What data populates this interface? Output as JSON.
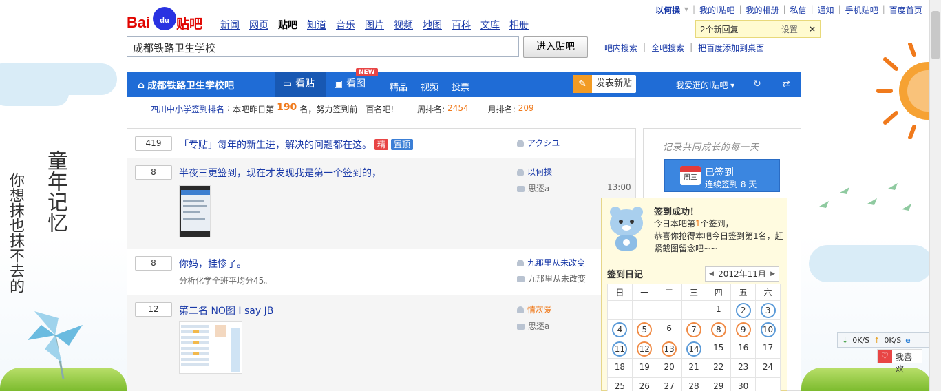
{
  "logo": {
    "bai": "Bai",
    "du": "du",
    "tieba": "贴吧"
  },
  "nav": [
    "新闻",
    "网页",
    "贴吧",
    "知道",
    "音乐",
    "图片",
    "视频",
    "地图",
    "百科",
    "文库",
    "相册"
  ],
  "nav_current": "贴吧",
  "search": {
    "value": "成都铁路卫生学校",
    "button": "进入贴吧"
  },
  "sublinks": [
    "吧内搜索",
    "全吧搜索",
    "把百度添加到桌面"
  ],
  "toplinks": {
    "user": "以何操",
    "items": [
      "我的i贴吧",
      "我的相册",
      "私信",
      "通知",
      "手机贴吧",
      "百度首页"
    ]
  },
  "notify": {
    "text": "2个新回复",
    "setting": "设置",
    "close": "×"
  },
  "bar": {
    "name": "成都铁路卫生学校吧",
    "tabs": [
      "看贴",
      "看图"
    ],
    "new": "NEW",
    "links": [
      "精品",
      "视频",
      "投票"
    ],
    "post": "发表新贴",
    "fav": "我爱逛的i贴吧"
  },
  "rank": {
    "label": "四川中小学签到排名",
    "pre": "本吧昨日第",
    "num": "190",
    "post": "名，努力签到前一百名吧!",
    "week_label": "周排名:",
    "week": "2454",
    "month_label": "月排名:",
    "month": "209"
  },
  "threads": [
    {
      "count": "419",
      "title": "「专贴」每年的新生进，解决的问题都在这。",
      "badges": [
        "精",
        "置顶"
      ],
      "author": "アクシユ"
    },
    {
      "count": "8",
      "title": "半夜三更签到，现在才发现我是第一个签到的，",
      "author": "以何操",
      "replier": "思逐a",
      "time": "13:00"
    },
    {
      "count": "8",
      "title": "你妈，挂惨了。",
      "abstract": "分析化学全班平均分45。",
      "author": "九那里从未改变",
      "replier": "九那里从未改变"
    },
    {
      "count": "12",
      "title": "第二名 NO图 I say JB",
      "author": "情灰爱",
      "replier": "思逐a"
    }
  ],
  "side": {
    "motto": "记录共同成长的每一天",
    "signed": "已签到",
    "days": "连续签到 8 天",
    "weekday": "周三"
  },
  "popup": {
    "title": "签到成功！",
    "line1a": "今日本吧第",
    "line1n": "1",
    "line1b": "个签到，",
    "line2": "恭喜你抢得本吧今日签到第1名，赶紧截图留念吧~~",
    "diary": "签到日记",
    "month": "2012年11月"
  },
  "calendar": {
    "head": [
      "日",
      "一",
      "二",
      "三",
      "四",
      "五",
      "六"
    ],
    "weeks": [
      [
        {
          "d": ""
        },
        {
          "d": ""
        },
        {
          "d": ""
        },
        {
          "d": ""
        },
        {
          "d": "1"
        },
        {
          "d": "2",
          "m": "b"
        },
        {
          "d": "3",
          "m": "b"
        }
      ],
      [
        {
          "d": "4",
          "m": "b"
        },
        {
          "d": "5",
          "m": "o"
        },
        {
          "d": "6"
        },
        {
          "d": "7",
          "m": "o"
        },
        {
          "d": "8",
          "m": "o"
        },
        {
          "d": "9",
          "m": "o"
        },
        {
          "d": "10",
          "m": "b"
        }
      ],
      [
        {
          "d": "11",
          "m": "b"
        },
        {
          "d": "12",
          "m": "o"
        },
        {
          "d": "13",
          "m": "o"
        },
        {
          "d": "14",
          "m": "b"
        },
        {
          "d": "15"
        },
        {
          "d": "16"
        },
        {
          "d": "17"
        }
      ],
      [
        {
          "d": "18"
        },
        {
          "d": "19"
        },
        {
          "d": "20"
        },
        {
          "d": "21"
        },
        {
          "d": "22"
        },
        {
          "d": "23"
        },
        {
          "d": "24"
        }
      ],
      [
        {
          "d": "25"
        },
        {
          "d": "26"
        },
        {
          "d": "27"
        },
        {
          "d": "28"
        },
        {
          "d": "29"
        },
        {
          "d": "30"
        },
        {
          "d": ""
        }
      ]
    ]
  },
  "netspeed": {
    "down": "0K/S",
    "up": "0K/S"
  },
  "like": "我喜欢",
  "deco": {
    "line1": "童年记忆",
    "line2": "你想抹也抹不去的"
  }
}
